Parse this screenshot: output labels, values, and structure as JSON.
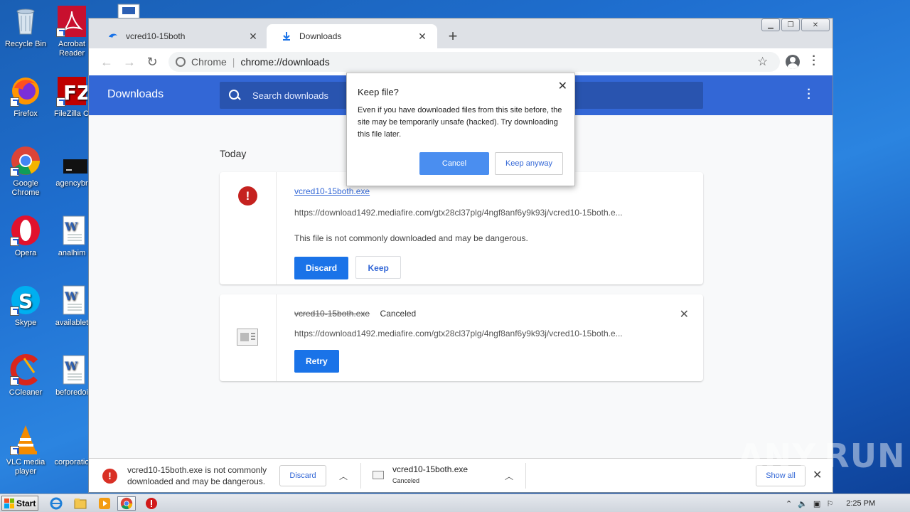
{
  "desktop": {
    "icons": [
      {
        "label": "Recycle Bin"
      },
      {
        "label": "Acrobat Reader"
      },
      {
        "label": "Firefox"
      },
      {
        "label": "FileZilla Cl"
      },
      {
        "label": "Google Chrome"
      },
      {
        "label": "agencybr"
      },
      {
        "label": "Opera"
      },
      {
        "label": "analhim"
      },
      {
        "label": "Skype"
      },
      {
        "label": "availablet"
      },
      {
        "label": "CCleaner"
      },
      {
        "label": "beforedoi"
      },
      {
        "label": "VLC media player"
      },
      {
        "label": "corporatio"
      }
    ]
  },
  "browser": {
    "tabs": [
      {
        "title": "vcred10-15both",
        "active": false
      },
      {
        "title": "Downloads",
        "active": true
      }
    ],
    "new_tab_symbol": "+",
    "omnibox": {
      "scheme": "Chrome",
      "separator": "|",
      "url": "chrome://downloads"
    }
  },
  "downloads_page": {
    "title": "Downloads",
    "search_placeholder": "Search downloads",
    "section_label": "Today",
    "items": [
      {
        "filename": "vcred10-15both.exe",
        "url": "https://download1492.mediafire.com/gtx28cl37plg/4ngf8anf6y9k93j/vcred10-15both.e...",
        "description": "This file is not commonly downloaded and may be dangerous.",
        "primary_button": "Discard",
        "secondary_button": "Keep"
      },
      {
        "filename": "vcred10-15both.exe",
        "status": "Canceled",
        "url": "https://download1492.mediafire.com/gtx28cl37plg/4ngf8anf6y9k93j/vcred10-15both.e...",
        "primary_button": "Retry"
      }
    ]
  },
  "dialog": {
    "title": "Keep file?",
    "body": "Even if you have downloaded files from this site before, the site may be temporarily unsafe (hacked). Try downloading this file later.",
    "cancel_label": "Cancel",
    "keep_label": "Keep anyway"
  },
  "shelf": {
    "item1_text": "vcred10-15both.exe is not commonly downloaded and may be dangerous.",
    "item1_button": "Discard",
    "item2_name": "vcred10-15both.exe",
    "item2_status": "Canceled",
    "show_all": "Show all"
  },
  "watermark": "ANY.RUN",
  "taskbar": {
    "start_label": "Start",
    "clock": "2:25 PM"
  },
  "colors": {
    "chrome_blue": "#3367d6",
    "button_blue": "#1a73e8",
    "danger_red": "#c5221f"
  }
}
